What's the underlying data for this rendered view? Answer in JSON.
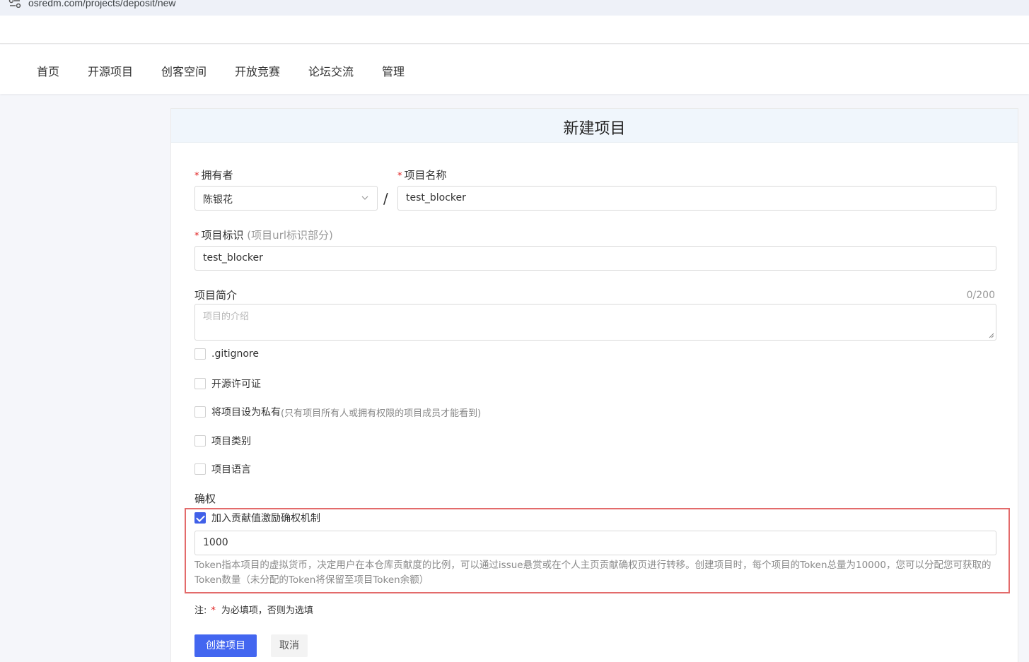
{
  "browser": {
    "url": "osredm.com/projects/deposit/new"
  },
  "nav": {
    "items": [
      "首页",
      "开源项目",
      "创客空间",
      "开放竞赛",
      "论坛交流",
      "管理"
    ]
  },
  "form": {
    "title": "新建项目",
    "owner_label": "拥有者",
    "owner_value": "陈银花",
    "separator": "/",
    "name_label": "项目名称",
    "name_value": "test_blocker",
    "id_label": "项目标识",
    "id_hint": "(项目url标识部分)",
    "id_value": "test_blocker",
    "desc_label": "项目简介",
    "desc_counter": "0/200",
    "desc_placeholder": "项目的介绍",
    "options": {
      "gitignore": ".gitignore",
      "license": "开源许可证",
      "private": "将项目设为私有",
      "private_hint": "(只有项目所有人或拥有权限的项目成员才能看到)",
      "category": "项目类别",
      "language": "项目语言"
    },
    "rights_label": "确权",
    "rights_checkbox": "加入贡献值激励确权机制",
    "rights_checked": true,
    "token_value": "1000",
    "token_desc": "Token指本项目的虚拟货币，决定用户在本仓库贡献度的比例，可以通过issue悬赏或在个人主页贡献确权页进行转移。创建项目时，每个项目的Token总量为10000，您可以分配您可获取的Token数量（未分配的Token将保留至项目Token余额）",
    "note_prefix": "注:",
    "note_star": "*",
    "note_text": "为必填项，否则为选填",
    "submit": "创建项目",
    "cancel": "取消"
  },
  "colors": {
    "primary": "#4366f0",
    "required": "#e02020",
    "highlight": "#e36b6b",
    "header_bg": "#f0f6fc"
  }
}
